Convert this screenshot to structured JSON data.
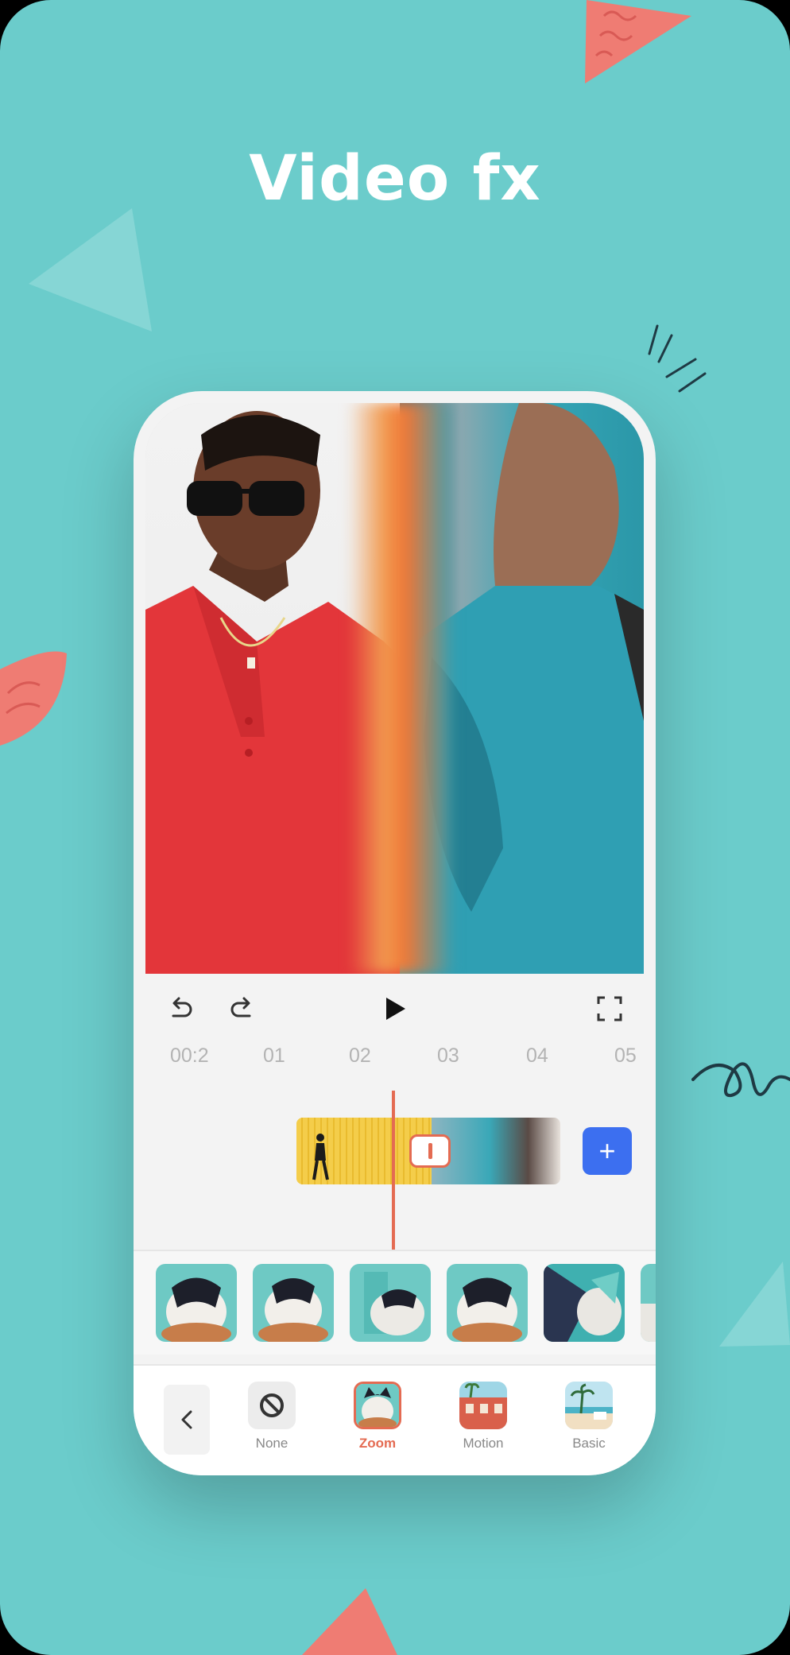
{
  "headline": "Video fx",
  "colors": {
    "background": "#6bcccb",
    "accent": "#e46b52",
    "add_button": "#3c6ff0"
  },
  "timeline": {
    "ticks": [
      "00:2",
      "01",
      "02",
      "03",
      "04",
      "05"
    ],
    "add_label": "+"
  },
  "effects": {
    "options": [
      {
        "label": "None",
        "icon": "no-symbol-icon",
        "active": false
      },
      {
        "label": "Zoom",
        "icon": "cat-thumbnail",
        "active": true
      },
      {
        "label": "Motion",
        "icon": "building-thumbnail",
        "active": false
      },
      {
        "label": "Basic",
        "icon": "beach-thumbnail",
        "active": false
      }
    ]
  }
}
